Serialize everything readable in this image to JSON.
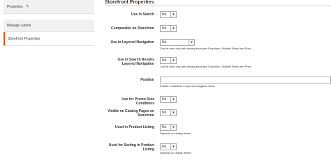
{
  "sidebar": {
    "items": [
      {
        "label": "Properties"
      },
      {
        "label": "Manage Labels"
      },
      {
        "label": "Storefront Properties"
      }
    ]
  },
  "section": {
    "title": "Storefront Properties"
  },
  "fields": {
    "use_in_search": {
      "label": "Use in Search",
      "value": "No"
    },
    "comparable": {
      "label": "Comparable on Storefront",
      "value": "No"
    },
    "layered_nav": {
      "label": "Use in Layered Navigation",
      "value": "No",
      "note": "Can be used only with catalog input type Dropdown, Multiple Select and Price."
    },
    "search_layered_nav": {
      "label": "Use in Search Results Layered Navigation",
      "value": "No",
      "note": "Can be used only with catalog input type Dropdown, Multiple Select and Price."
    },
    "position": {
      "label": "Position",
      "value": "",
      "note": "Position of attribute in layered navigation block."
    },
    "promo_rules": {
      "label": "Use for Promo Rule Conditions",
      "value": "No"
    },
    "catalog_visible": {
      "label": "Visible on Catalog Pages on Storefront",
      "value": "No"
    },
    "product_listing": {
      "label": "Used in Product Listing",
      "value": "No",
      "note": "Depends on design theme."
    },
    "sorting": {
      "label": "Used for Sorting in Product Listing",
      "value": "No",
      "note": "Depends on design theme."
    }
  },
  "colors": {
    "accent": "#eb5202",
    "sidebar_bg": "#f1f1f1",
    "border": "#adadad"
  },
  "icons": {
    "pencil": "pencil-icon",
    "dropdown": "chevron-down-icon"
  }
}
